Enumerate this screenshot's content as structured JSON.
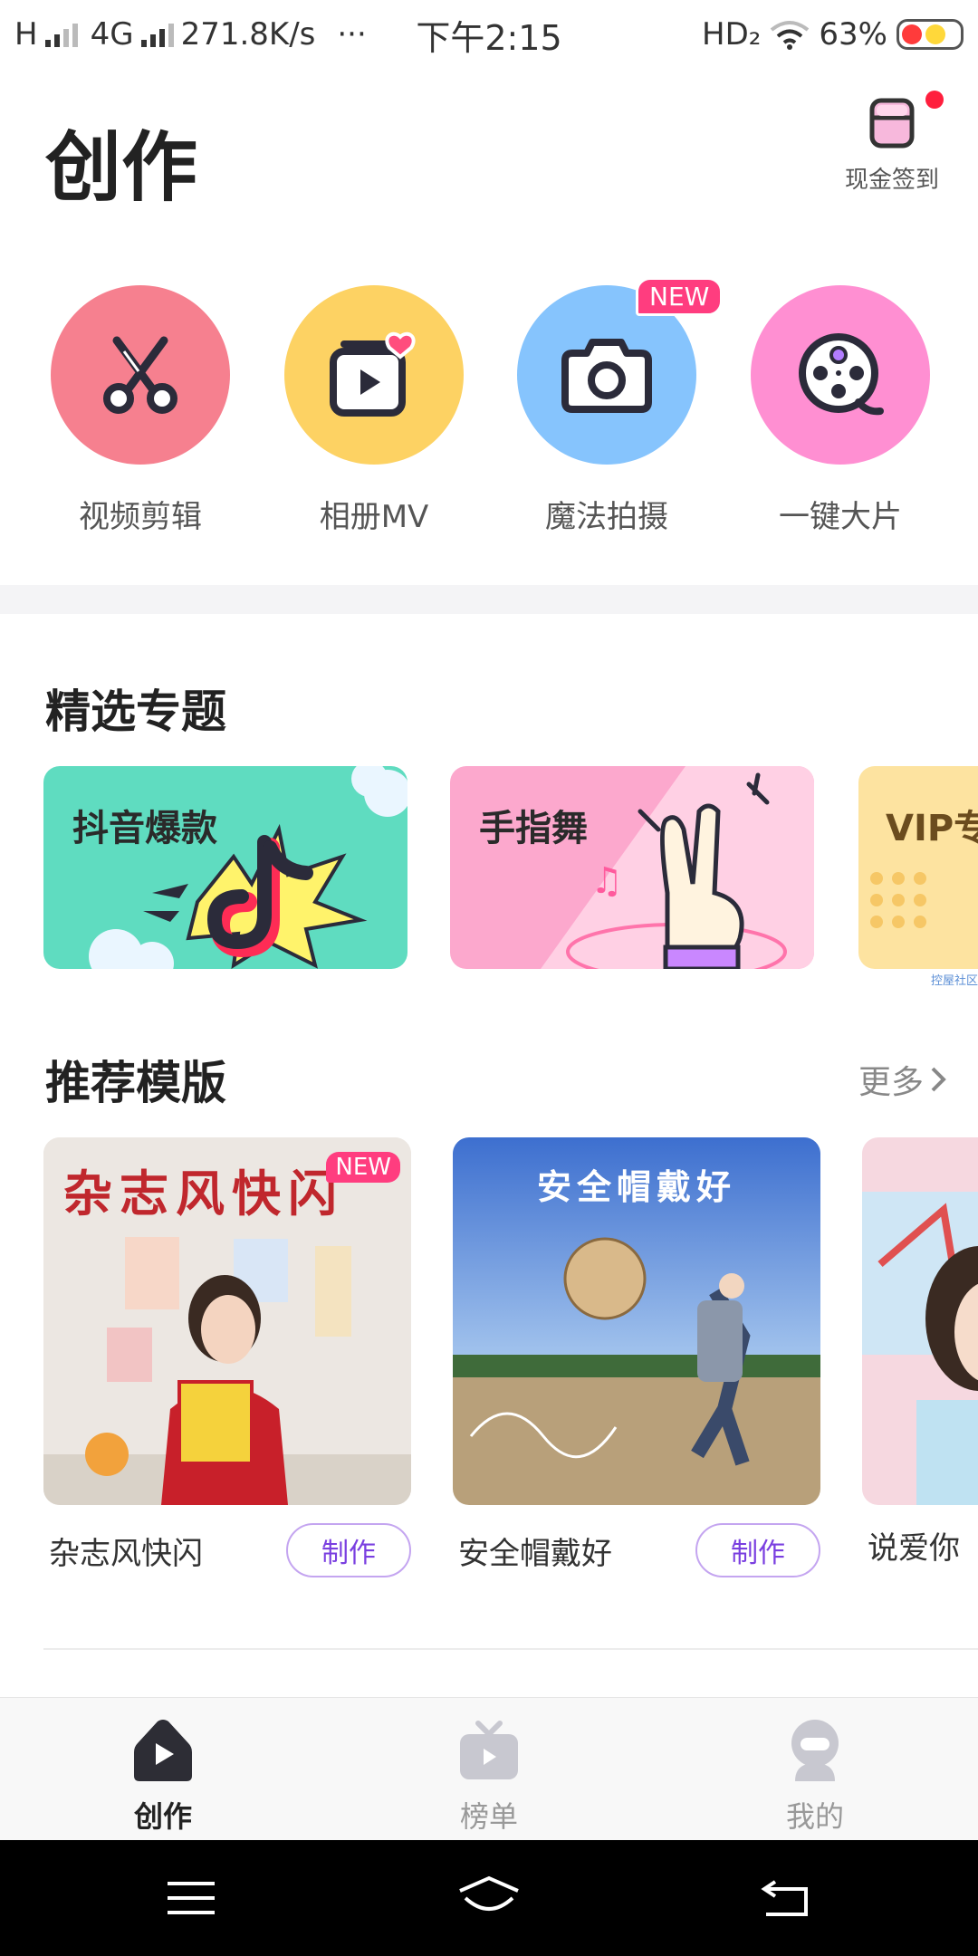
{
  "status_bar": {
    "left": "H",
    "network_type": "4G",
    "speed": "271.8K/s",
    "dots": "···",
    "time": "下午2:15",
    "hd": "HD₂",
    "battery": "63%"
  },
  "header": {
    "title": "创作",
    "checkin_label": "现金签到"
  },
  "tools": [
    {
      "label": "视频剪辑",
      "icon": "scissors-icon",
      "color": "#f6808f"
    },
    {
      "label": "相册MV",
      "icon": "album-play-icon",
      "color": "#fdd263"
    },
    {
      "label": "魔法拍摄",
      "icon": "camera-icon",
      "color": "#86c4fd",
      "badge": "NEW"
    },
    {
      "label": "一键大片",
      "icon": "film-reel-icon",
      "color": "#ff8fd2"
    }
  ],
  "featured": {
    "title": "精选专题",
    "items": [
      {
        "name": "抖音爆款",
        "color": "#5fdcc0"
      },
      {
        "name": "手指舞",
        "color": "#fca8cd"
      },
      {
        "name": "VIP专",
        "color": "#fde3a0"
      }
    ],
    "watermark": "控屋社区"
  },
  "recommended": {
    "title": "推荐模版",
    "more": "更多",
    "items": [
      {
        "title": "杂志风快闪",
        "thumb_text": "杂志风快闪",
        "badge": "NEW",
        "button": "制作"
      },
      {
        "title": "安全帽戴好",
        "thumb_text": "安全帽戴好",
        "button": "制作"
      },
      {
        "title": "说爱你"
      }
    ]
  },
  "bottom_nav": [
    {
      "label": "创作",
      "icon": "create-play-icon",
      "active": true
    },
    {
      "label": "榜单",
      "icon": "tv-chart-icon",
      "active": false
    },
    {
      "label": "我的",
      "icon": "profile-icon",
      "active": false
    }
  ]
}
